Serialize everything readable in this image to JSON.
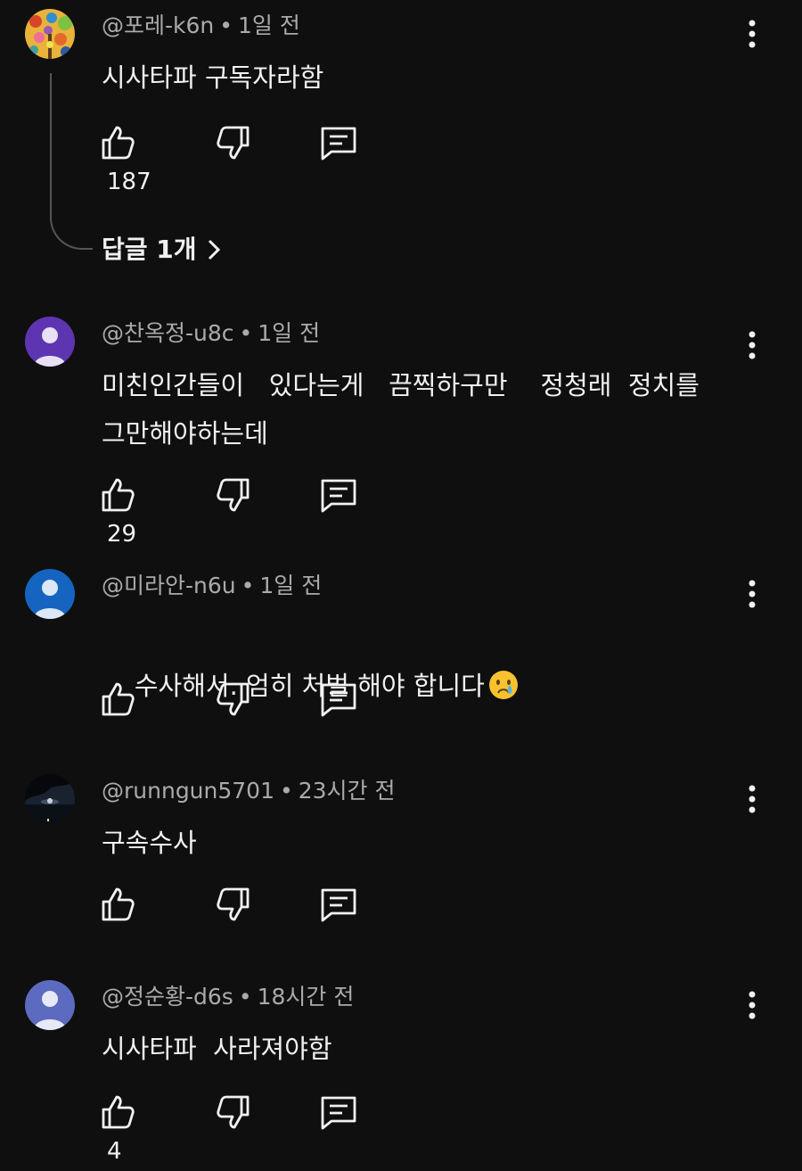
{
  "comments": [
    {
      "author": "@포레-k6n",
      "time": "1일 전",
      "text": "시사타파 구독자라함",
      "likes": "187",
      "replies_label": "답글 1개",
      "avatar_type": "painted-tree-image"
    },
    {
      "author": "@찬옥정-u8c",
      "time": "1일 전",
      "text": "미친인간들이   있다는게   끔찍하구만    정청래  정치를\n그만해야하는데",
      "likes": "29",
      "avatar_color": "#5e35b1"
    },
    {
      "author": "@미라안-n6u",
      "time": "1일 전",
      "text": "수사해서. 엄히 처벌 해야 합니다",
      "emoji": "crying-face-emoji",
      "likes": "",
      "avatar_color": "#1565c0"
    },
    {
      "author": "@runngun5701",
      "time": "23시간 전",
      "text": "구속수사",
      "likes": "",
      "avatar_type": "night-landscape-image"
    },
    {
      "author": "@정순황-d6s",
      "time": "18시간 전",
      "text": "시사타파  사라져야함",
      "likes": "4",
      "avatar_color": "#5c6bc0"
    }
  ],
  "icons": {
    "like": "thumb-up-icon",
    "dislike": "thumb-down-icon",
    "reply": "comment-reply-icon",
    "more": "more-vert-icon",
    "chevron": "chevron-right-icon"
  },
  "colors": {
    "background": "#0f0f0f",
    "text": "#f1f1f1",
    "meta": "#aaaaaa"
  }
}
